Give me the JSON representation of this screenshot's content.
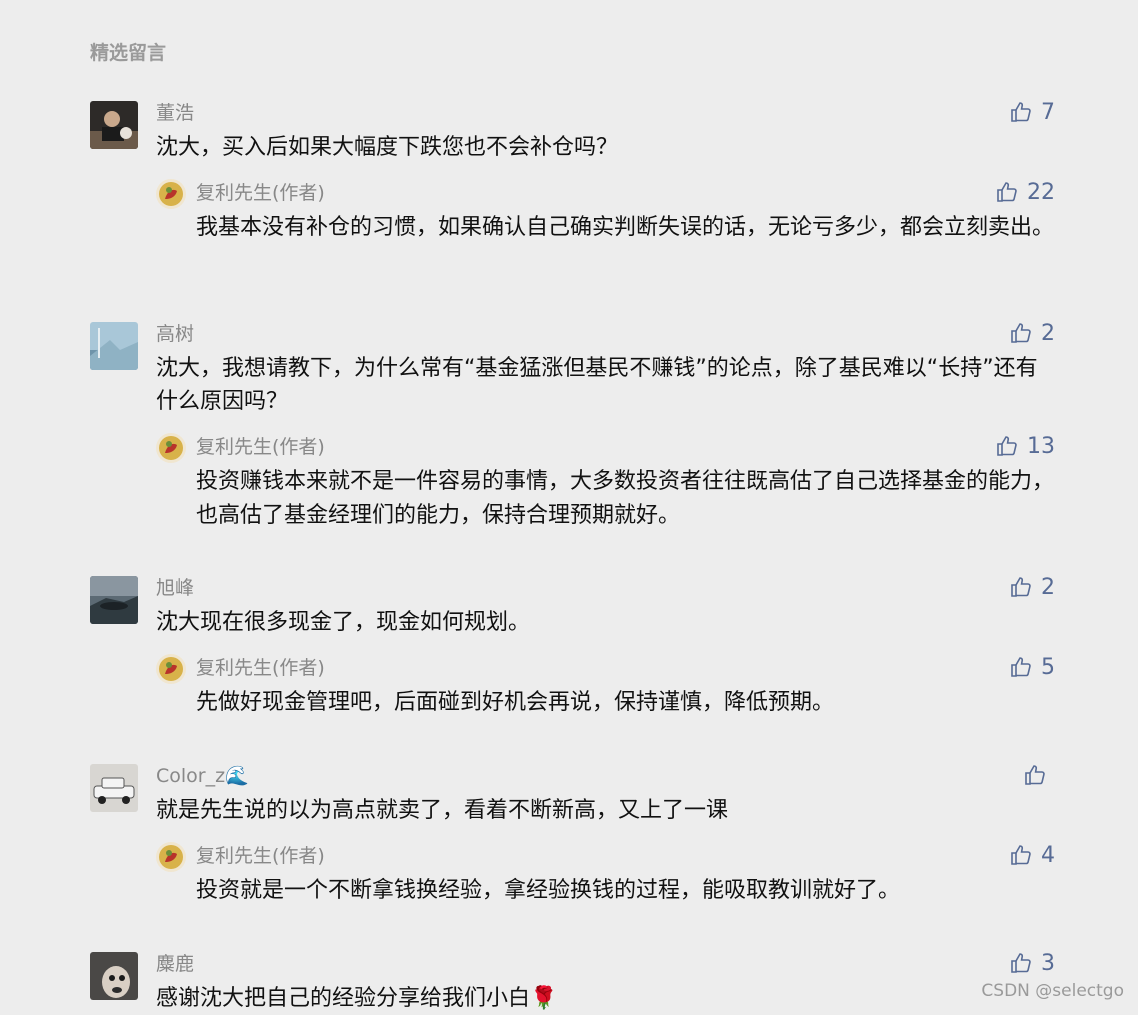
{
  "section_title": "精选留言",
  "comments": [
    {
      "author": "董浩",
      "text": "沈大，买入后如果大幅度下跌您也不会补仓吗？",
      "likes": "7",
      "reply": {
        "author": "复利先生(作者)",
        "text": "我基本没有补仓的习惯，如果确认自己确实判断失误的话，无论亏多少，都会立刻卖出。",
        "likes": "22"
      }
    },
    {
      "author": "高树",
      "text": "沈大，我想请教下，为什么常有“基金猛涨但基民不赚钱”的论点，除了基民难以“长持”还有什么原因吗？",
      "likes": "2",
      "reply": {
        "author": "复利先生(作者)",
        "text": "投资赚钱本来就不是一件容易的事情，大多数投资者往往既高估了自己选择基金的能力，也高估了基金经理们的能力，保持合理预期就好。",
        "likes": "13"
      }
    },
    {
      "author": "旭峰",
      "text": "沈大现在很多现金了，现金如何规划。",
      "likes": "2",
      "reply": {
        "author": "复利先生(作者)",
        "text": "先做好现金管理吧，后面碰到好机会再说，保持谨慎，降低预期。",
        "likes": "5"
      }
    },
    {
      "author": "Color_z🌊",
      "text": "就是先生说的以为高点就卖了，看着不断新高，又上了一课",
      "likes": "",
      "reply": {
        "author": "复利先生(作者)",
        "text": "投资就是一个不断拿钱换经验，拿经验换钱的过程，能吸取教训就好了。",
        "likes": "4"
      }
    },
    {
      "author": "麋鹿",
      "text": "感谢沈大把自己的经验分享给我们小白🌹",
      "likes": "3"
    }
  ],
  "watermark": "CSDN @selectgo",
  "colors": {
    "background": "#ededed",
    "like_blue": "#576b95",
    "name_gray": "#888888"
  }
}
